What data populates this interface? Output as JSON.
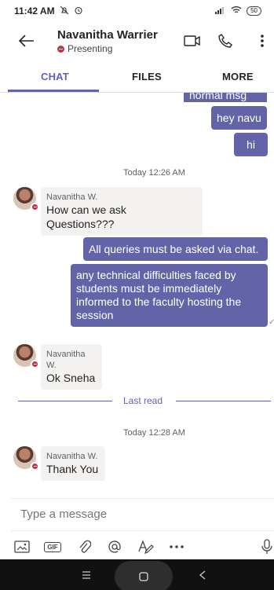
{
  "status_bar": {
    "time": "11:42 AM",
    "battery": "50"
  },
  "header": {
    "name": "Navanitha Warrier",
    "presence": "Presenting"
  },
  "tabs": {
    "chat": "CHAT",
    "files": "FILES",
    "more": "MORE"
  },
  "messages": {
    "partial_top": "normal msg",
    "out1": "hey navu",
    "out2": "hi",
    "time1": "Today 12:26 AM",
    "in1_sender": "Navanitha W.",
    "in1_text": "How can we ask Questions???",
    "out3": "All queries must be asked via chat.",
    "out4": "any technical difficulties faced by students must be immediately informed to the faculty hosting the session",
    "in2_sender": "Navanitha W.",
    "in2_text": "Ok Sneha",
    "last_read": "Last read",
    "time2": "Today 12:28 AM",
    "in3_sender": "Navanitha W.",
    "in3_text": "Thank You"
  },
  "compose": {
    "placeholder": "Type a message"
  },
  "toolbar": {
    "gif_label": "GIF"
  },
  "colors": {
    "accent": "#6264a7",
    "presence": "#c4314b"
  }
}
